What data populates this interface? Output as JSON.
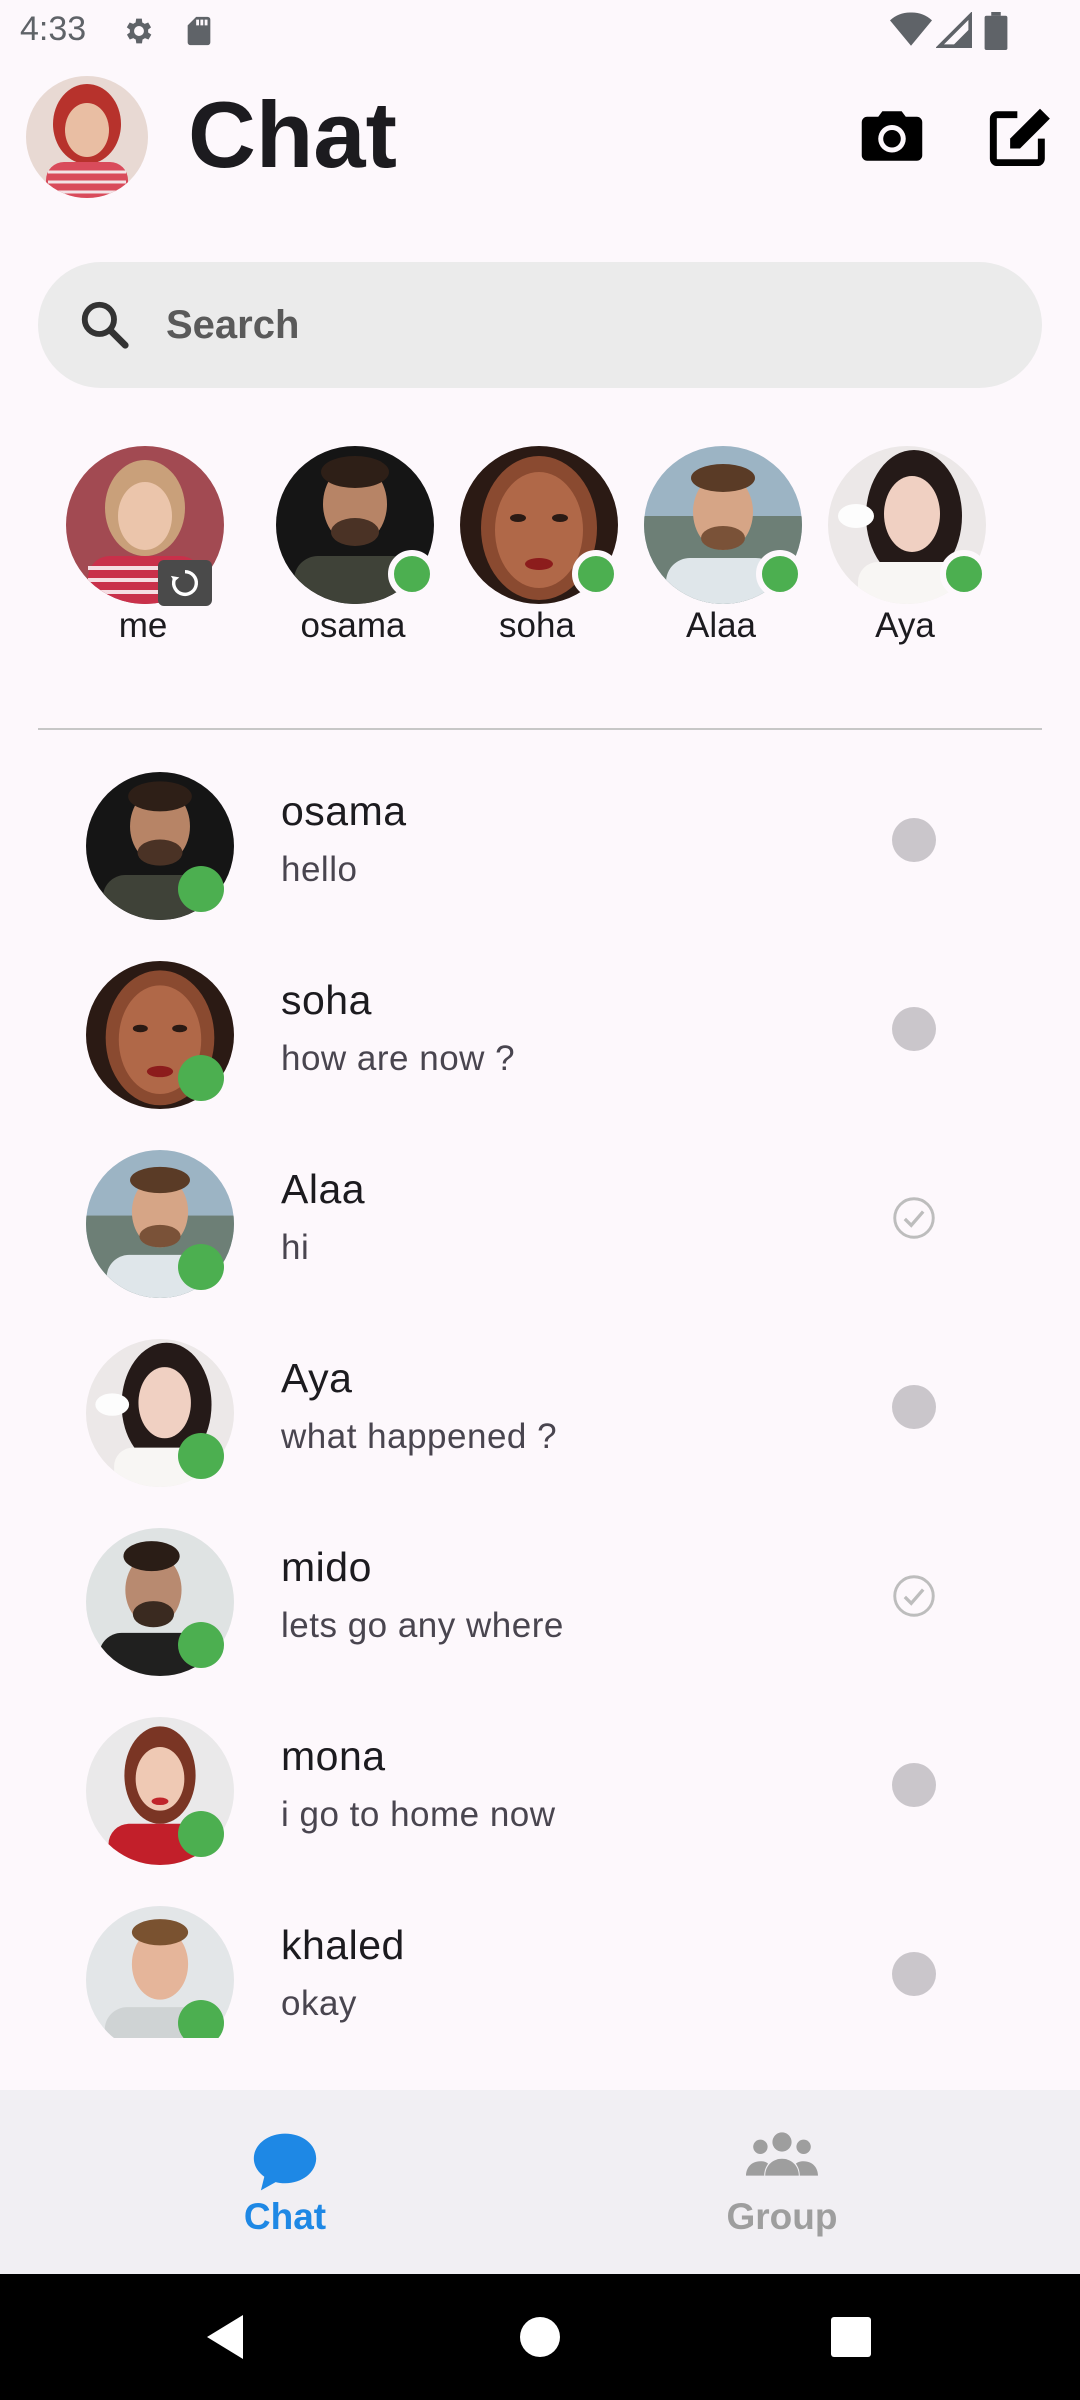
{
  "status_bar": {
    "time": "4:33",
    "icons": [
      "gear-icon",
      "sd-card-icon",
      "wifi-icon",
      "signal-icon",
      "battery-icon"
    ]
  },
  "header": {
    "title": "Chat",
    "actions": [
      "camera-icon",
      "edit-icon"
    ]
  },
  "search": {
    "placeholder": "Search"
  },
  "stories": [
    {
      "name": "me",
      "type": "self"
    },
    {
      "name": "osama",
      "online": true
    },
    {
      "name": "soha",
      "online": true
    },
    {
      "name": "Alaa",
      "online": true
    },
    {
      "name": "Aya",
      "online": true
    }
  ],
  "chats": [
    {
      "name": "osama",
      "message": "hello",
      "status": "unread"
    },
    {
      "name": "soha",
      "message": "how are now ?",
      "status": "unread"
    },
    {
      "name": "Alaa",
      "message": "hi",
      "status": "read"
    },
    {
      "name": "Aya",
      "message": "what happened ?",
      "status": "unread"
    },
    {
      "name": "mido",
      "message": "lets go any where",
      "status": "read"
    },
    {
      "name": "mona",
      "message": "i go to  home now",
      "status": "unread"
    },
    {
      "name": "khaled",
      "message": "okay",
      "status": "unread"
    }
  ],
  "bottom_nav": {
    "chat_label": "Chat",
    "group_label": "Group",
    "active": "Chat"
  },
  "colors": {
    "background": "#fdf8fc",
    "online_green": "#4caf50",
    "active_blue": "#1e88e5",
    "inactive_gray": "#9e9e9e",
    "search_bg": "#ebebeb"
  }
}
